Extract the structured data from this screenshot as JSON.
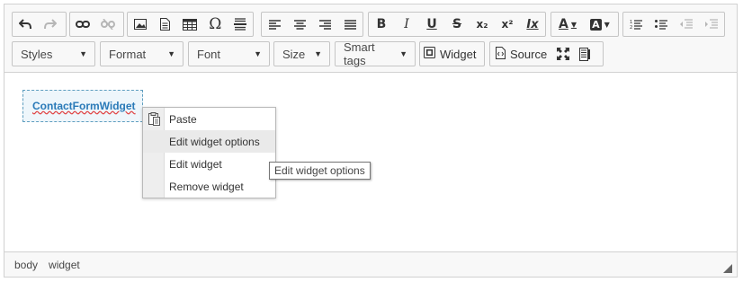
{
  "toolbar": {
    "row1": {
      "undo_icon": "undo-icon",
      "redo_icon": "redo-icon",
      "link_icon": "link-icon",
      "unlink_icon": "unlink-icon",
      "image_icon": "image-icon",
      "document_icon": "document-icon",
      "table_icon": "table-icon",
      "special_char_glyph": "Ω",
      "hr_icon": "horizontal-rule-icon",
      "align_icons": [
        "align-left-icon",
        "align-center-icon",
        "align-right-icon",
        "align-justify-icon"
      ],
      "bold": "B",
      "italic": "I",
      "underline": "U",
      "strike": "S",
      "subscript": "x₂",
      "superscript": "x²",
      "remove_format": "Ix",
      "text_color": "A",
      "bg_color": "A",
      "list_icons": [
        "numbered-list-icon",
        "bulleted-list-icon",
        "outdent-icon",
        "indent-icon"
      ]
    },
    "row2": {
      "styles": "Styles",
      "format": "Format",
      "font": "Font",
      "size": "Size",
      "smart_tags": "Smart tags",
      "widget": "Widget",
      "source": "Source",
      "maximize_icon": "maximize-icon",
      "show_blocks_icon": "show-blocks-icon"
    }
  },
  "content": {
    "widget_label": "ContactFormWidget"
  },
  "context_menu": {
    "items": [
      {
        "label": "Paste",
        "icon": "paste-icon"
      },
      {
        "label": "Edit widget options"
      },
      {
        "label": "Edit widget"
      },
      {
        "label": "Remove widget"
      }
    ]
  },
  "tooltip": "Edit widget options",
  "statusbar": {
    "path": [
      "body",
      "widget"
    ]
  },
  "colors": {
    "toolbar_bg": "#f8f8f8",
    "border": "#d1d1d1",
    "widget_text": "#2a7ab8",
    "widget_border": "#5f9ebf"
  }
}
